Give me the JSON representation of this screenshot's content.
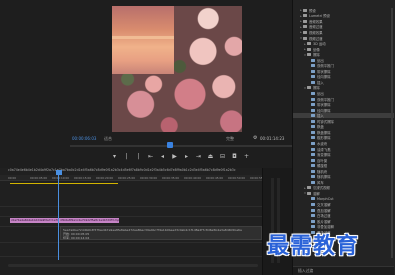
{
  "monitor": {
    "timecode_current": "00:00:06:03",
    "zoom": "适合",
    "quality": "完整",
    "timecode_duration": "00:01:14:23",
    "controls": [
      "marker-icon",
      "mark-in-icon",
      "mark-out-icon",
      "go-to-in-icon",
      "step-back-icon",
      "play-icon",
      "step-forward-icon",
      "go-to-out-icon",
      "lift-icon",
      "extract-icon",
      "export-frame-icon",
      "button-editor-icon"
    ]
  },
  "effects_panel": {
    "items": [
      {
        "label": "预设",
        "depth": 1,
        "expanded": false,
        "type": "folder"
      },
      {
        "label": "Lumetri 预设",
        "depth": 1,
        "expanded": false,
        "type": "folder"
      },
      {
        "label": "音频效果",
        "depth": 1,
        "expanded": false,
        "type": "folder"
      },
      {
        "label": "音频过渡",
        "depth": 1,
        "expanded": false,
        "type": "folder"
      },
      {
        "label": "视频效果",
        "depth": 1,
        "expanded": false,
        "type": "folder"
      },
      {
        "label": "视频过渡",
        "depth": 1,
        "expanded": true,
        "type": "folder"
      },
      {
        "label": "3D 运动",
        "depth": 2,
        "expanded": false,
        "type": "folder"
      },
      {
        "label": "划像",
        "depth": 2,
        "expanded": false,
        "type": "folder"
      },
      {
        "label": "擦除",
        "depth": 2,
        "expanded": true,
        "type": "folder"
      },
      {
        "label": "划出",
        "depth": 3,
        "type": "fx"
      },
      {
        "label": "双侧平推门",
        "depth": 3,
        "type": "fx"
      },
      {
        "label": "带状擦除",
        "depth": 3,
        "type": "fx"
      },
      {
        "label": "径向擦除",
        "depth": 3,
        "type": "fx"
      },
      {
        "label": "插入",
        "depth": 3,
        "type": "fx"
      },
      {
        "label": "擦除",
        "depth": 2,
        "expanded": true,
        "type": "folder"
      },
      {
        "label": "划出",
        "depth": 3,
        "type": "fx"
      },
      {
        "label": "双侧平推门",
        "depth": 3,
        "type": "fx"
      },
      {
        "label": "带状擦除",
        "depth": 3,
        "type": "fx"
      },
      {
        "label": "径向擦除",
        "depth": 3,
        "type": "fx"
      },
      {
        "label": "插入",
        "depth": 3,
        "type": "fx",
        "selected": true
      },
      {
        "label": "时钟式擦除",
        "depth": 3,
        "type": "fx"
      },
      {
        "label": "棋盘",
        "depth": 3,
        "type": "fx"
      },
      {
        "label": "棋盘擦除",
        "depth": 3,
        "type": "fx"
      },
      {
        "label": "楔形擦除",
        "depth": 3,
        "type": "fx"
      },
      {
        "label": "水波块",
        "depth": 3,
        "type": "fx"
      },
      {
        "label": "油漆飞溅",
        "depth": 3,
        "type": "fx"
      },
      {
        "label": "渐变擦除",
        "depth": 3,
        "type": "fx"
      },
      {
        "label": "百叶窗",
        "depth": 3,
        "type": "fx"
      },
      {
        "label": "螺旋框",
        "depth": 3,
        "type": "fx"
      },
      {
        "label": "随机块",
        "depth": 3,
        "type": "fx"
      },
      {
        "label": "随机擦除",
        "depth": 3,
        "type": "fx"
      },
      {
        "label": "风车",
        "depth": 3,
        "type": "fx"
      },
      {
        "label": "沉浸式视频",
        "depth": 2,
        "expanded": false,
        "type": "folder"
      },
      {
        "label": "溶解",
        "depth": 2,
        "expanded": true,
        "type": "folder"
      },
      {
        "label": "MorphCut",
        "depth": 3,
        "type": "fx"
      },
      {
        "label": "交叉溶解",
        "depth": 3,
        "type": "fx"
      },
      {
        "label": "叠加溶解",
        "depth": 3,
        "type": "fx"
      },
      {
        "label": "白场过渡",
        "depth": 3,
        "type": "fx"
      },
      {
        "label": "胶片溶解",
        "depth": 3,
        "type": "fx"
      },
      {
        "label": "非叠加溶解",
        "depth": 3,
        "type": "fx"
      },
      {
        "label": "黑场过渡",
        "depth": 3,
        "type": "fx"
      },
      {
        "label": "滑动",
        "depth": 2,
        "expanded": false,
        "type": "folder"
      },
      {
        "label": "缩放",
        "depth": 2,
        "expanded": false,
        "type": "folder"
      },
      {
        "label": "页面剥落",
        "depth": 2,
        "expanded": false,
        "type": "folder"
      }
    ],
    "status": "插入过渡"
  },
  "timeline": {
    "sequence_name": "c0a74e4e6b4e1b2d4a9f2a7c1e7ba7ba0c2d1e4f5a6b7c8d9e0f1a2b3c4d5e6f7a8b9c0d1e2f3a4b5c6d7e8f9a0b1c2d3e4f5a6b7c8d9e0f1a2b3c",
    "ruler_labels": [
      "00:00",
      "00:00:05:00",
      "00:00:10:00",
      "00:00:15:00",
      "00:00:20:00",
      "00:00:25:00",
      "00:00:30:00",
      "00:00:35:00",
      "00:00:40:00",
      "00:00:45:00",
      "00:00:50:00",
      "00:00:55:00"
    ],
    "clip_a": "c0a74e4e6b4e1b2d4a9f2a7c1e7ba7ba.mp4",
    "clip_b": "d3b6e8f2a1c4e7b9d2f5a8c1e4b7d0f3.mp4",
    "tooltip_title": "5ea7a0be72ddb0b3f37fae4b7e9ea8fe8abe472aa8bec39a4bc7f4a1b0beed3c0ab4c1f1d8a2f7c8d6e5b4a3a8d4b5ba6a",
    "tooltip_start": "开始: 00:00:05:05",
    "tooltip_end": "结束: 00:00:14:04",
    "tooltip_duration": "持续时间: 00:00:09:00"
  },
  "watermark": "最需教育"
}
